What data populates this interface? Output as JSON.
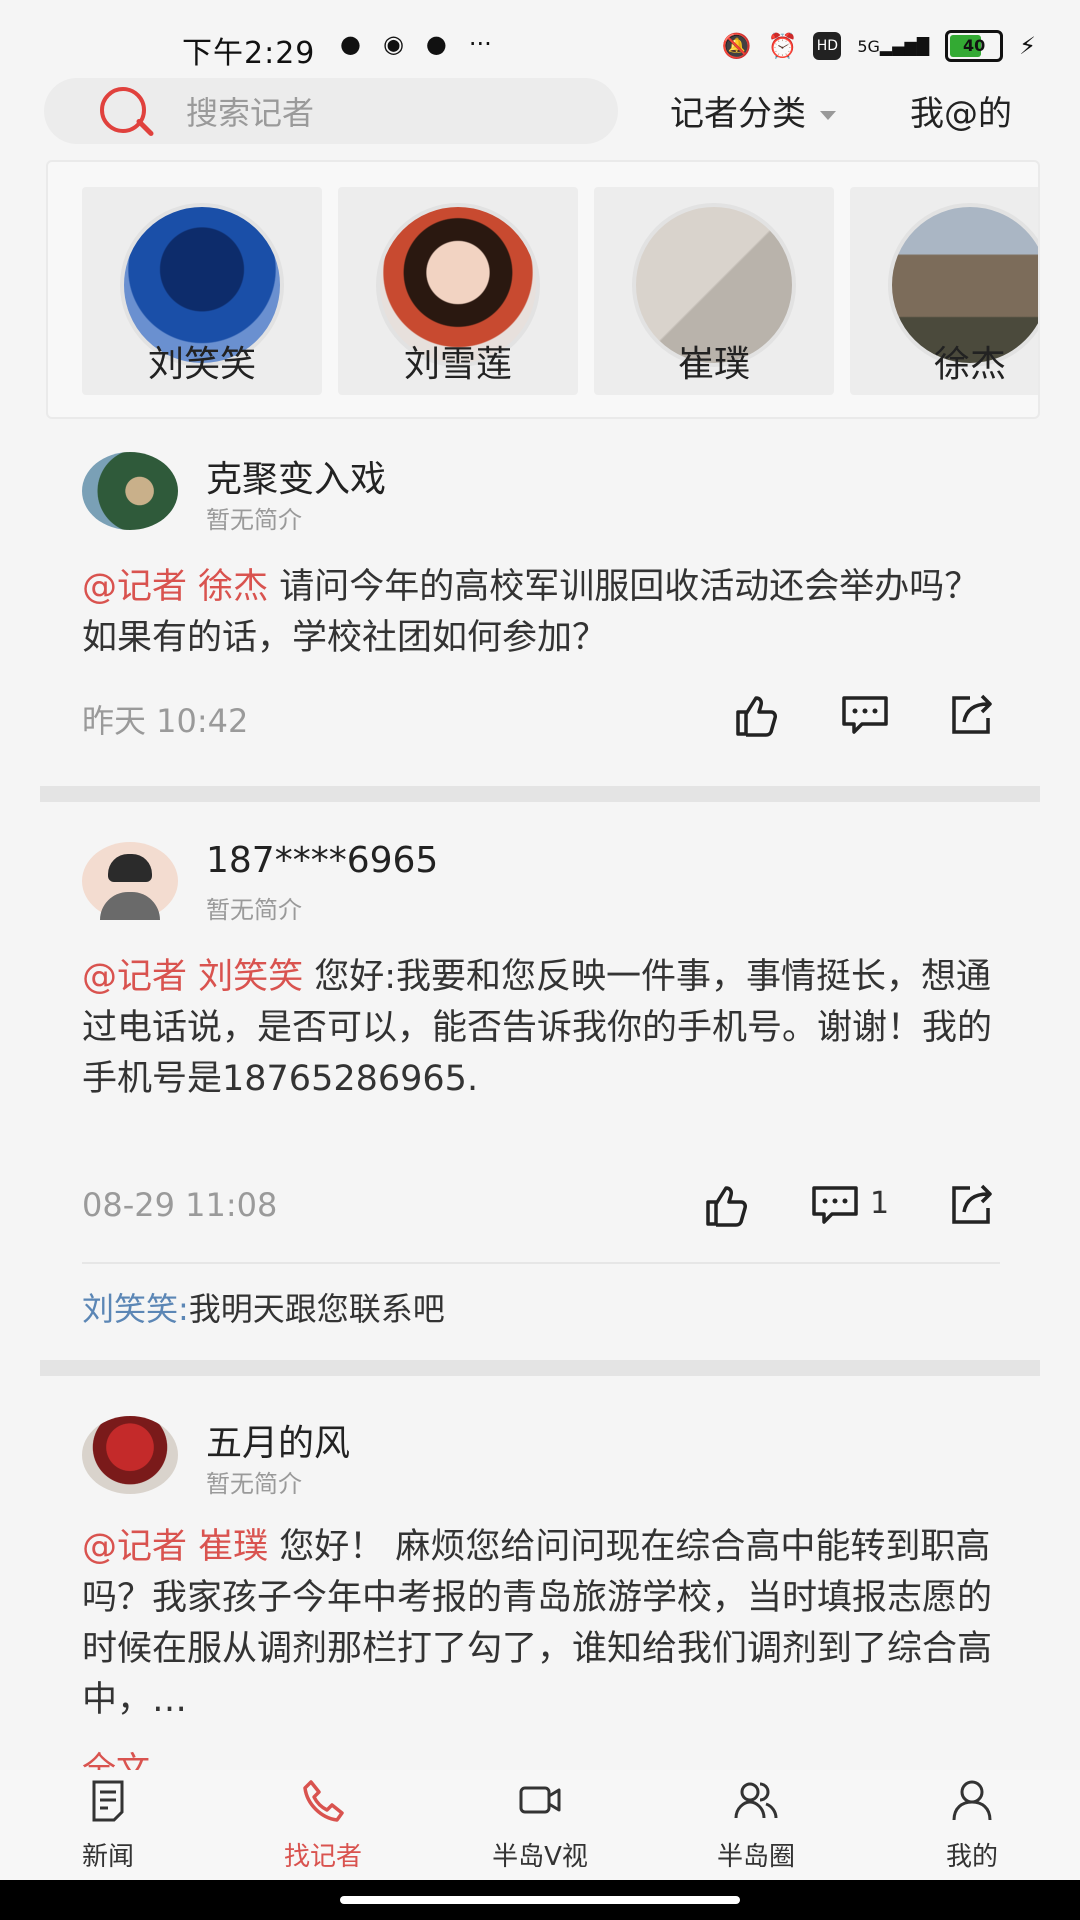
{
  "status_bar": {
    "time": "下午2:29",
    "left_icons": [
      "wechat-icon",
      "record-icon",
      "chat-icon",
      "more-icon"
    ],
    "hd": "HD",
    "signal": "5G",
    "battery": "40"
  },
  "top_bar": {
    "search_placeholder": "搜索记者",
    "category_label": "记者分类",
    "my_at_label": "我@的"
  },
  "reporters": [
    {
      "name": "刘笑笑"
    },
    {
      "name": "刘雪莲"
    },
    {
      "name": "崔璞"
    },
    {
      "name": "徐杰"
    }
  ],
  "posts": [
    {
      "user": "克聚变入戏",
      "bio": "暂无简介",
      "mention": "@记者 徐杰",
      "text": " 请问今年的高校军训服回收活动还会举办吗？如果有的话，学校社团如何参加？",
      "time": "昨天 10:42",
      "comment_count": ""
    },
    {
      "user": "187****6965",
      "bio": "暂无简介",
      "mention": "@记者 刘笑笑",
      "text": " 您好:我要和您反映一件事，事情挺长，想通过电话说，是否可以，能否告诉我你的手机号。谢谢！我的手机号是18765286965.",
      "time": "08-29 11:08",
      "comment_count": "1",
      "reply_name": "刘笑笑:",
      "reply_text": "我明天跟您联系吧"
    },
    {
      "user": "五月的风",
      "bio": "暂无简介",
      "mention": "@记者 崔璞",
      "text": " 您好！ 麻烦您给问问现在综合高中能转到职高吗？我家孩子今年中考报的青岛旅游学校，当时填报志愿的时候在服从调剂那栏打了勾了，谁知给我们调剂到了综合高中，…",
      "full_text_label": "全文"
    }
  ],
  "tab_bar": {
    "tabs": [
      {
        "label": "新闻",
        "icon": "news-icon"
      },
      {
        "label": "找记者",
        "icon": "phone-icon"
      },
      {
        "label": "半岛V视",
        "icon": "video-icon"
      },
      {
        "label": "半岛圈",
        "icon": "group-icon"
      },
      {
        "label": "我的",
        "icon": "person-icon"
      }
    ],
    "active": "找记者"
  },
  "colors": {
    "accent": "#d9534f",
    "reply_name": "#5b86b5"
  }
}
